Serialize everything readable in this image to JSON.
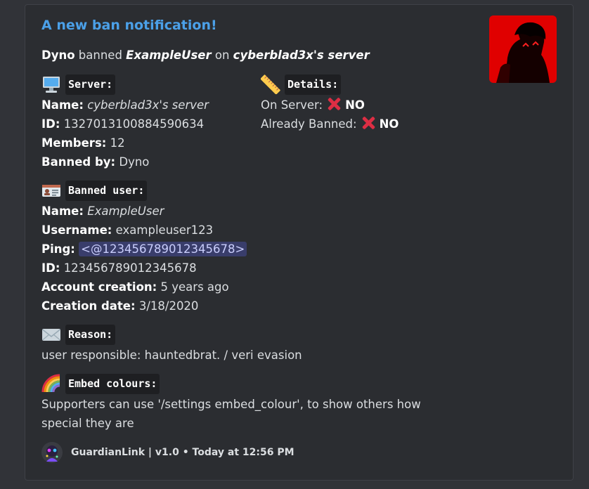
{
  "embed": {
    "title": "A new ban notification!",
    "description": {
      "actor": "Dyno",
      "verb": " banned ",
      "target": "ExampleUser",
      "on": " on ",
      "server": "cyberblad3x's server"
    },
    "server_field": {
      "icon": "computer-icon",
      "heading": "Server:",
      "name_label": "Name:",
      "name_value": "cyberblad3x's server",
      "id_label": "ID:",
      "id_value": "1327013100884590634",
      "members_label": "Members:",
      "members_value": "12",
      "banned_by_label": "Banned by:",
      "banned_by_value": "Dyno"
    },
    "details_field": {
      "icon": "ruler-icon",
      "heading": "Details:",
      "on_server_label": "On Server:",
      "on_server_value": "NO",
      "already_banned_label": "Already Banned:",
      "already_banned_value": "NO"
    },
    "banned_user_field": {
      "icon": "id-card-icon",
      "heading": "Banned user:",
      "name_label": "Name:",
      "name_value": "ExampleUser",
      "username_label": "Username:",
      "username_value": "exampleuser123",
      "ping_label": "Ping:",
      "ping_value": "<@123456789012345678>",
      "id_label": "ID:",
      "id_value": "123456789012345678",
      "account_creation_label": "Account creation:",
      "account_creation_value": "5 years ago",
      "creation_date_label": "Creation date:",
      "creation_date_value": "3/18/2020"
    },
    "reason_field": {
      "icon": "envelope-icon",
      "heading": "Reason:",
      "value": "user responsible: hauntedbrat. / veri evasion"
    },
    "embed_colours_field": {
      "icon": "rainbow-icon",
      "heading": "Embed colours:",
      "line1": "Supporters can use '/settings embed_colour', to show others how",
      "line2": "special they are"
    },
    "footer": {
      "text": "GuardianLink | v1.0 • Today at 12:56 PM"
    }
  },
  "colors": {
    "background": "#313338",
    "embed_bg": "#2b2d31",
    "title": "#4ba0e8",
    "mention_bg": "#3c4270",
    "xmark": "#dd2e44"
  }
}
